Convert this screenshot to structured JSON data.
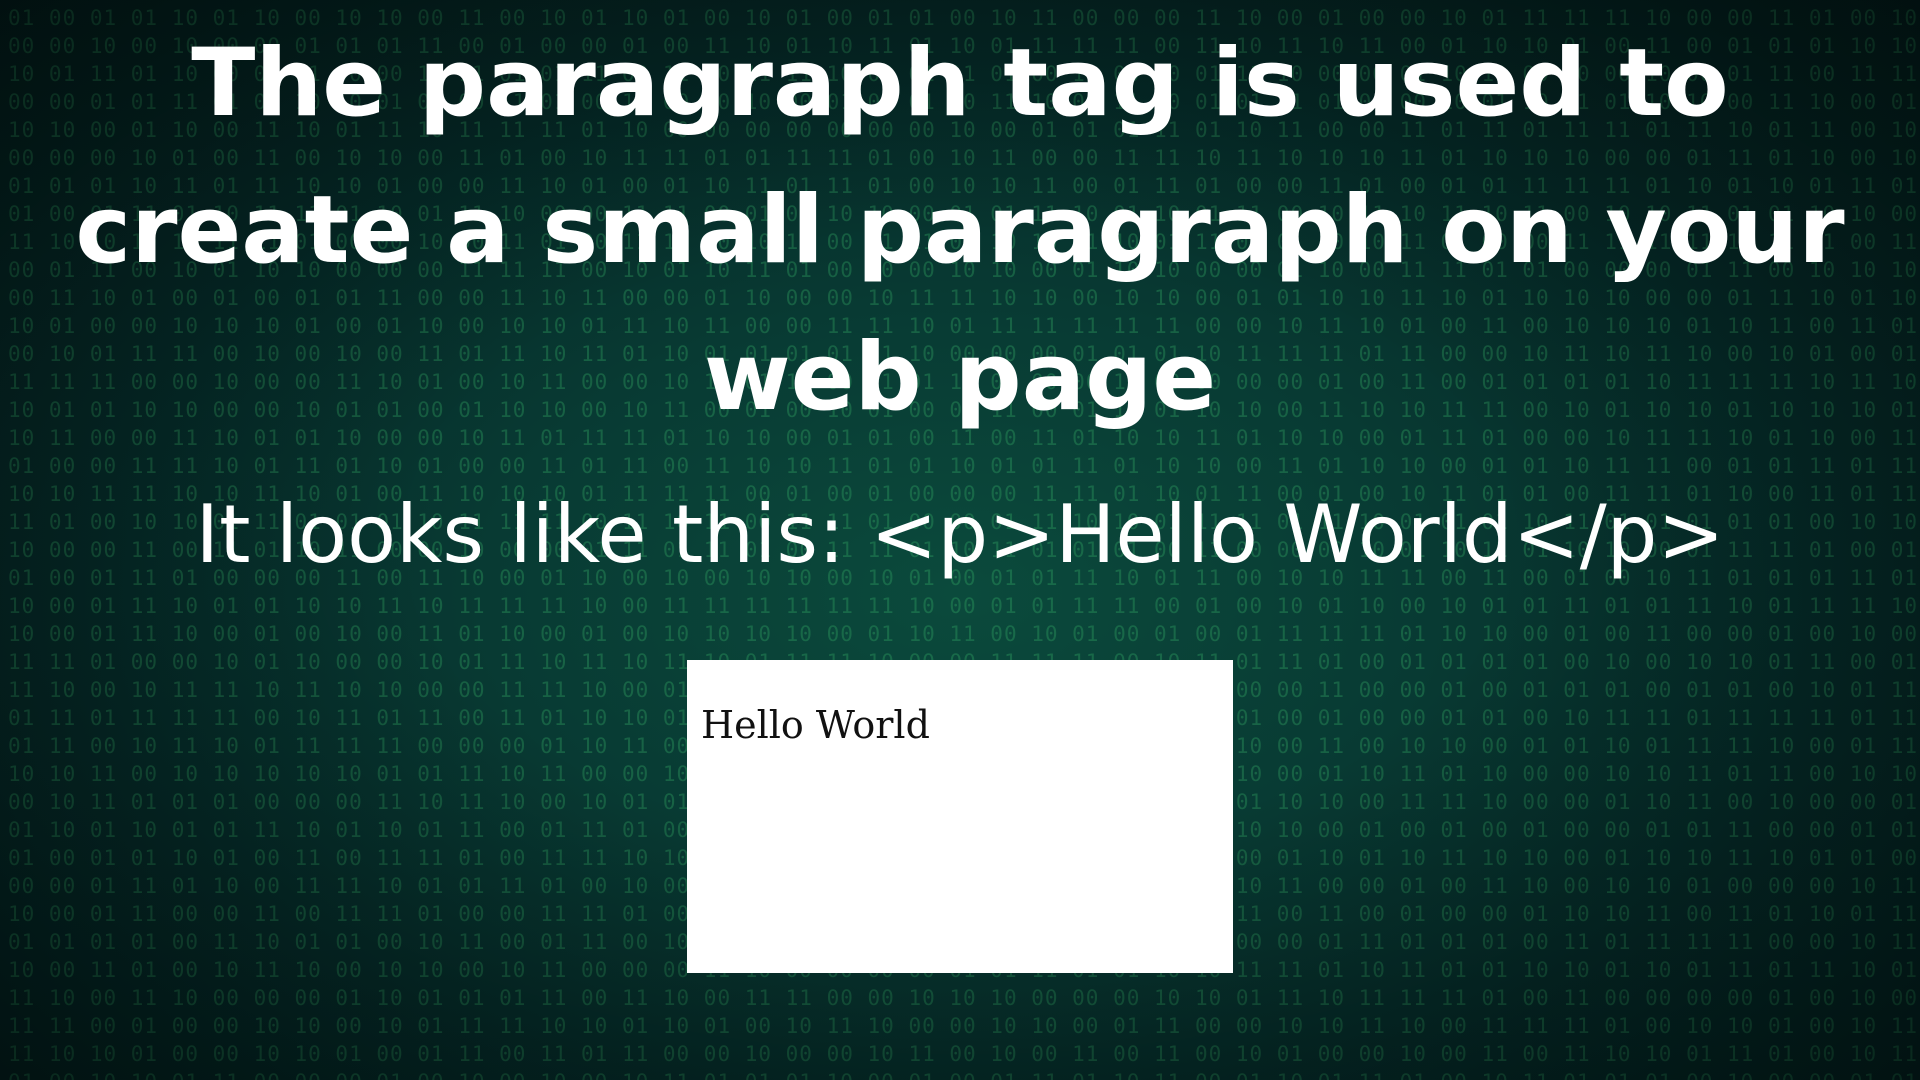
{
  "colors": {
    "background": "#063330",
    "binary_digits": "#3cbe6e",
    "heading_text": "#ffffff",
    "preview_background": "#ffffff",
    "preview_text": "#111111"
  },
  "heading": {
    "text": "The paragraph tag is used to create a small paragraph on your web page"
  },
  "subheading": {
    "text": "It looks like this: <p>Hello World</p>"
  },
  "preview": {
    "text": "Hello World"
  }
}
